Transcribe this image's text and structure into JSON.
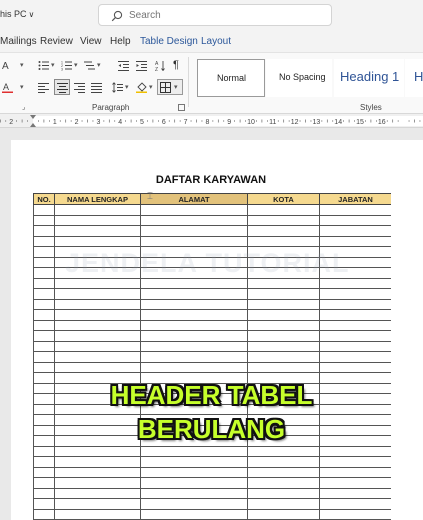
{
  "titlebar": {
    "location": "his PC",
    "search_placeholder": "Search"
  },
  "menu": {
    "items": [
      "Mailings",
      "Review",
      "View",
      "Help",
      "Table Design",
      "Layout"
    ]
  },
  "ribbon": {
    "paragraph_label": "Paragraph",
    "styles_label": "Styles",
    "styles": [
      "Normal",
      "No Spacing",
      "Heading 1",
      "H"
    ],
    "pilcrow": "¶"
  },
  "ruler": {
    "marks": [
      "1",
      "2",
      "1",
      "2",
      "3",
      "4",
      "5",
      "6",
      "7",
      "8",
      "9",
      "10",
      "11",
      "12",
      "13",
      "14",
      "15",
      "16"
    ]
  },
  "document": {
    "title": "DAFTAR KARYAWAN",
    "table": {
      "headers": [
        "NO.",
        "NAMA LENGKAP",
        "ALAMAT",
        "KOTA",
        "JABATAN"
      ],
      "header_colors": {
        "default": "#f5d98f",
        "selected": "#e2c27b"
      }
    },
    "watermark": "JENDELA TUTORIAL"
  },
  "overlay": {
    "line1": "HEADER TABEL",
    "line2": "BERULANG",
    "color": "#c6ff2b"
  }
}
